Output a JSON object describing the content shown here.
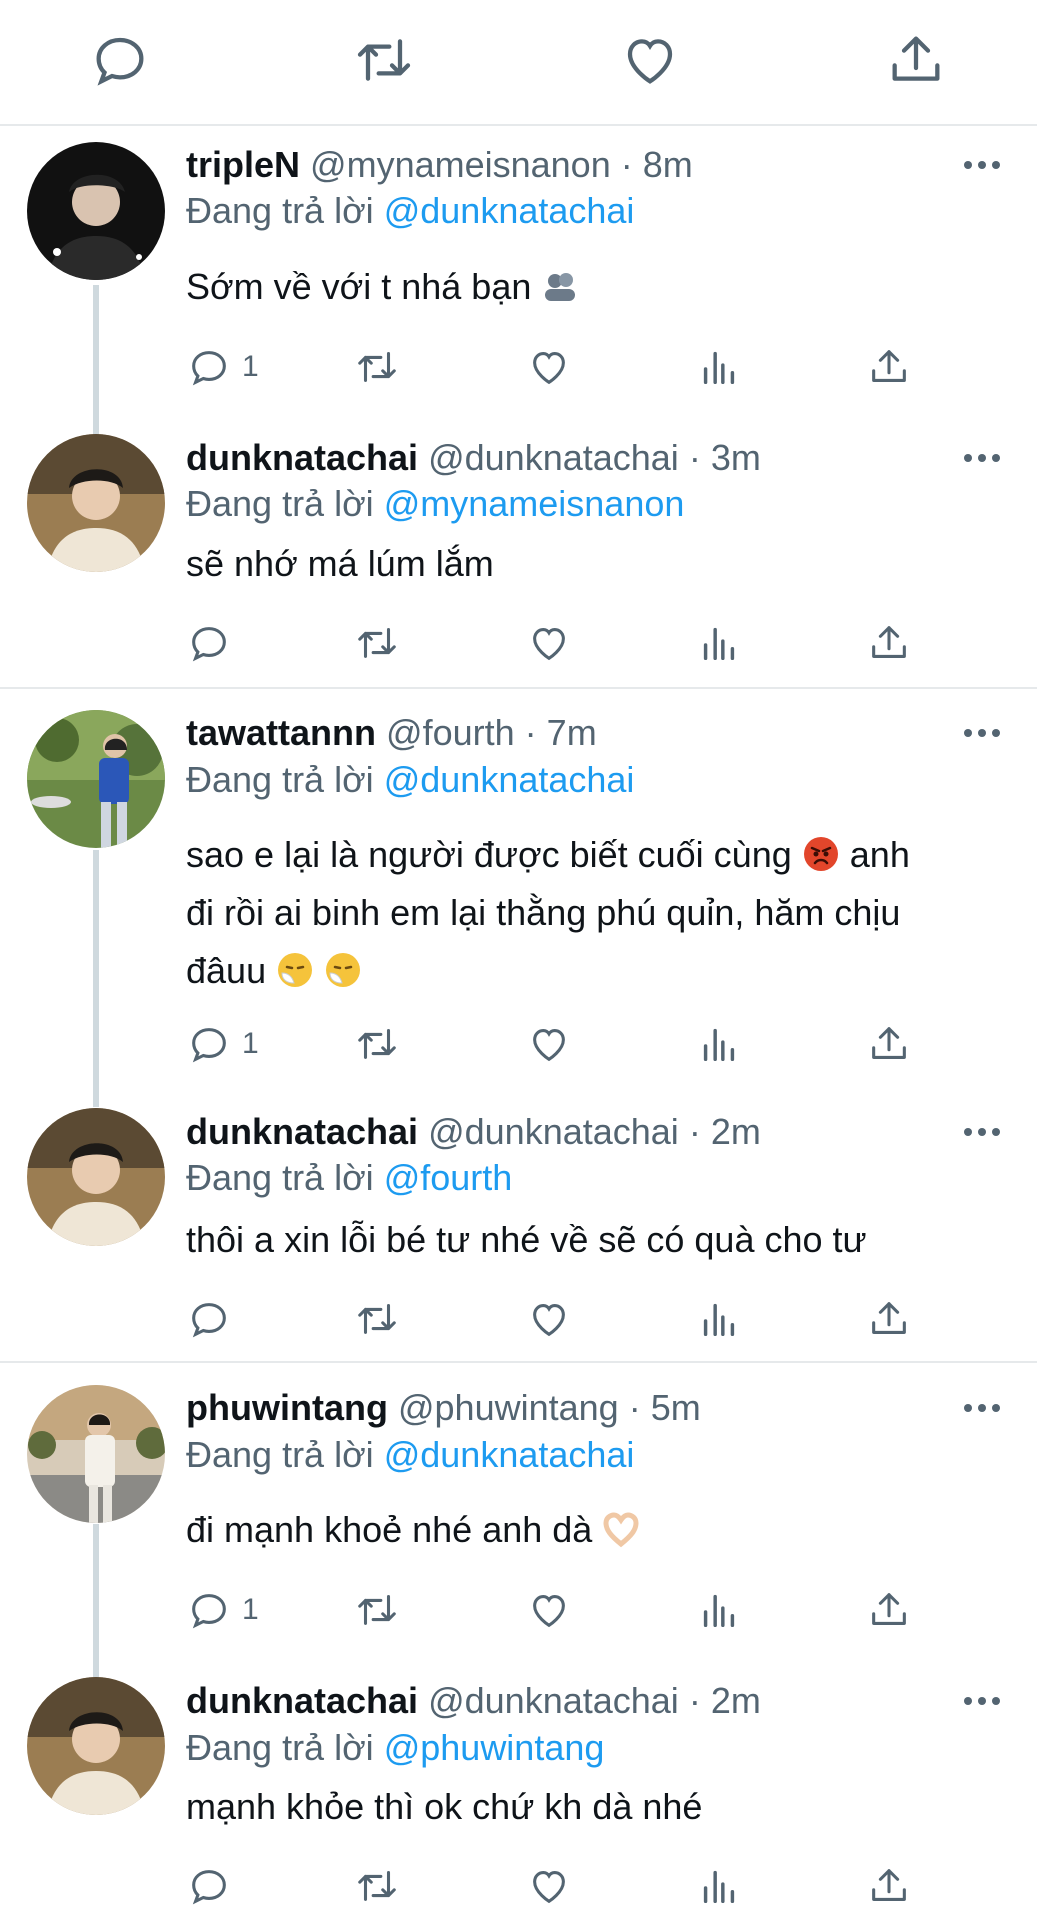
{
  "top_actions": [
    {
      "name": "reply-icon"
    },
    {
      "name": "retweet-icon"
    },
    {
      "name": "like-icon"
    },
    {
      "name": "share-icon"
    }
  ],
  "colors": {
    "accent": "#1d9bf0",
    "secondary_text": "#536471",
    "divider": "#e6e9eb",
    "thread_line": "#cfd9de"
  },
  "tweets": [
    {
      "name": "tripleN",
      "handle": "@mynameisnanon",
      "dot": "·",
      "time": "8m",
      "replying_prefix": "Đang trả lời",
      "mention": "@dunknatachai",
      "lines": [
        "Sớm về với t nhá bạn"
      ],
      "emoji": "busts-in-silhouette",
      "reply_count": "1"
    },
    {
      "name": "dunknatachai",
      "handle": "@dunknatachai",
      "dot": "·",
      "time": "3m",
      "replying_prefix": "Đang trả lời",
      "mention": "@mynameisnanon",
      "lines": [
        "sẽ nhớ má lúm lắm"
      ],
      "reply_count": ""
    },
    {
      "name": "tawattannn",
      "handle": "@fourth",
      "dot": "·",
      "time": "7m",
      "replying_prefix": "Đang trả lời",
      "mention": "@dunknatachai",
      "lines": [
        "sao e lại là người được biết cuối cùng",
        "anh",
        "đi rồi ai binh em lại thằng phú quỉn, hăm chịu",
        "đâuu"
      ],
      "emoji": "angry-face",
      "emoji2": "sneezing-face",
      "reply_count": "1"
    },
    {
      "name": "dunknatachai",
      "handle": "@dunknatachai",
      "dot": "·",
      "time": "2m",
      "replying_prefix": "Đang trả lời",
      "mention": "@fourth",
      "lines": [
        "thôi a xin lỗi bé tư nhé về sẽ có quà cho tư"
      ],
      "reply_count": ""
    },
    {
      "name": "phuwintang",
      "handle": "@phuwintang",
      "dot": "·",
      "time": "5m",
      "replying_prefix": "Đang trả lời",
      "mention": "@dunknatachai",
      "lines": [
        "đi mạnh khoẻ nhé anh dà"
      ],
      "emoji": "heart-hands",
      "reply_count": "1"
    },
    {
      "name": "dunknatachai",
      "handle": "@dunknatachai",
      "dot": "·",
      "time": "2m",
      "replying_prefix": "Đang trả lời",
      "mention": "@phuwintang",
      "lines": [
        "mạnh khỏe thì ok chứ kh dà nhé"
      ],
      "reply_count": ""
    }
  ]
}
